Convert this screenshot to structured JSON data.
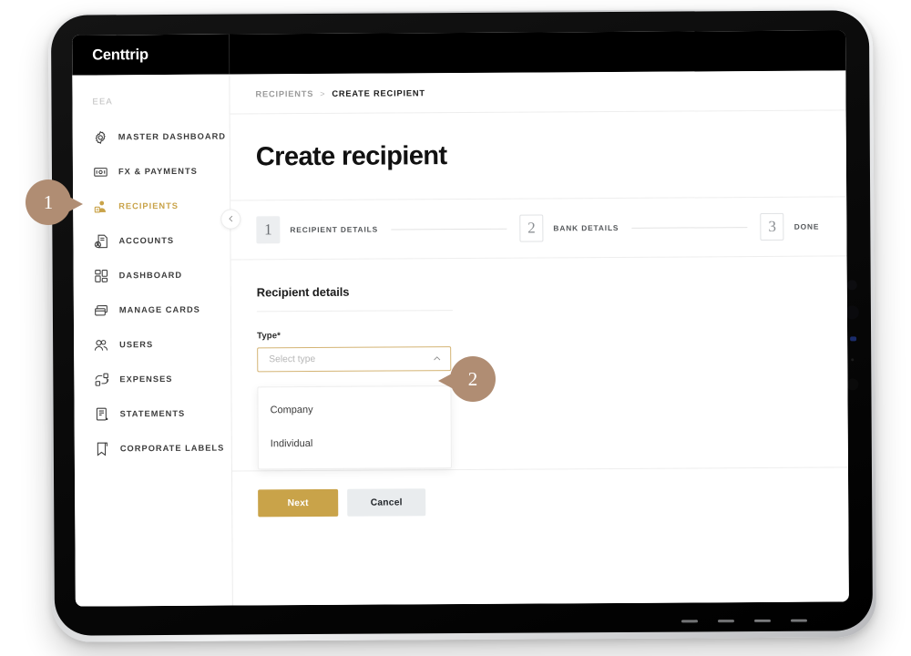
{
  "app": {
    "brand": "Centtrip"
  },
  "sidebar": {
    "section_label": "EEA",
    "collapse_icon": "chevron-left-icon",
    "items": [
      {
        "label": "MASTER DASHBOARD",
        "icon": "gear-icon",
        "active": false
      },
      {
        "label": "FX & PAYMENTS",
        "icon": "banknote-icon",
        "active": false
      },
      {
        "label": "RECIPIENTS",
        "icon": "person-card-icon",
        "active": true
      },
      {
        "label": "ACCOUNTS",
        "icon": "account-document-icon",
        "active": false
      },
      {
        "label": "DASHBOARD",
        "icon": "grid-icon",
        "active": false
      },
      {
        "label": "MANAGE CARDS",
        "icon": "cards-icon",
        "active": false
      },
      {
        "label": "USERS",
        "icon": "users-icon",
        "active": false
      },
      {
        "label": "EXPENSES",
        "icon": "expenses-icon",
        "active": false
      },
      {
        "label": "STATEMENTS",
        "icon": "statement-icon",
        "active": false
      },
      {
        "label": "CORPORATE LABELS",
        "icon": "label-tag-icon",
        "active": false
      }
    ]
  },
  "breadcrumb": {
    "previous": "RECIPIENTS",
    "separator": ">",
    "current": "CREATE RECIPIENT"
  },
  "page": {
    "title": "Create recipient"
  },
  "stepper": {
    "steps": [
      {
        "number": "1",
        "label": "RECIPIENT DETAILS",
        "state": "active"
      },
      {
        "number": "2",
        "label": "BANK DETAILS",
        "state": "inactive"
      },
      {
        "number": "3",
        "label": "DONE",
        "state": "inactive"
      }
    ]
  },
  "form": {
    "heading": "Recipient details",
    "type_field": {
      "label": "Type*",
      "placeholder": "Select type",
      "value": "",
      "chevron_icon": "chevron-up-icon",
      "expanded": true,
      "options": [
        {
          "label": "Company"
        },
        {
          "label": "Individual"
        }
      ]
    }
  },
  "actions": {
    "primary_label": "Next",
    "secondary_label": "Cancel"
  },
  "callouts": [
    {
      "number": "1"
    },
    {
      "number": "2"
    }
  ],
  "colors": {
    "brand_gold": "#c9a349",
    "callout_tan": "#b08d73",
    "topbar_black": "#000000",
    "select_border_gold": "#d4b474",
    "secondary_button_grey": "#e9ecee"
  }
}
